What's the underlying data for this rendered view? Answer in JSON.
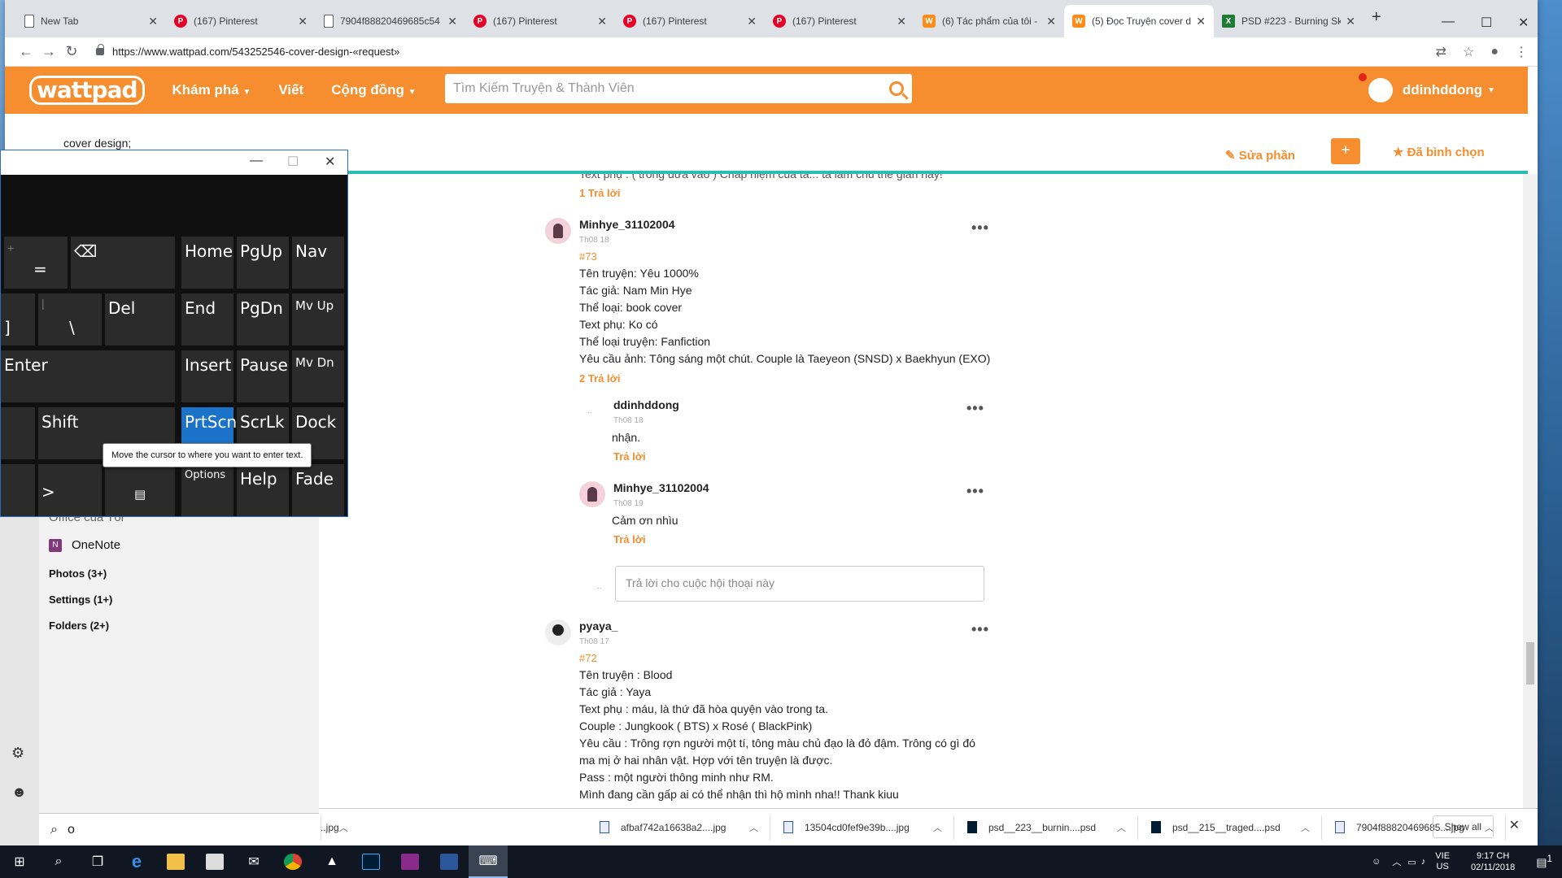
{
  "browser": {
    "tabs": [
      {
        "title": "New Tab",
        "icon": "doc"
      },
      {
        "title": "(167) Pinterest",
        "icon": "pin"
      },
      {
        "title": "7904f88820469685c54",
        "icon": "doc"
      },
      {
        "title": "(167) Pinterest",
        "icon": "pin"
      },
      {
        "title": "(167) Pinterest",
        "icon": "pin"
      },
      {
        "title": "(167) Pinterest",
        "icon": "pin"
      },
      {
        "title": "(6) Tác phẩm của tôi -",
        "icon": "wp"
      },
      {
        "title": "(5) Đọc Truyện cover d",
        "icon": "wp"
      },
      {
        "title": "PSD #223 - Burning Sk",
        "icon": "psd"
      }
    ],
    "url": "https://www.wattpad.com/543252546-cover-design-«request»"
  },
  "wattpad": {
    "logo": "wattpad",
    "menu": [
      "Khám phá",
      "Viết",
      "Cộng đồng"
    ],
    "search_placeholder": "Tìm Kiếm Truyện & Thành Viên",
    "username": "ddinhddong",
    "story_title": "cover design;",
    "edit_label": "Sửa phần",
    "plus_label": "+",
    "vote_label": "Đã bình chọn"
  },
  "comments": {
    "top_partial": "Text phụ : ( trong đưa vào ) Chấp niệm của ta... ta làm chủ thế gian này!",
    "top_reply_count": "1 Trả lời",
    "c73": {
      "user": "Minhye_31102004",
      "time": "Th08 18",
      "num": "#73",
      "lines": [
        "Tên truyện: Yêu 1000%",
        "Tác giả: Nam Min Hye",
        "Thể loại: book cover",
        "Text phụ: Ko có",
        "Thể loại truyện: Fanfiction",
        "Yêu cầu ảnh: Tông sáng một chút. Couple là Taeyeon (SNSD) x Baekhyun (EXO)"
      ],
      "reply_count": "2 Trả lời"
    },
    "r1": {
      "user": "ddinhddong",
      "time": "Th08 18",
      "text": "nhận.",
      "reply": "Trả lời"
    },
    "r2": {
      "user": "Minhye_31102004",
      "time": "Th08 19",
      "text": "Cảm ơn nhìu",
      "reply": "Trả lời"
    },
    "reply_placeholder": "Trả lời cho cuộc hội thoại này",
    "c72": {
      "user": "pyaya_",
      "time": "Th08 17",
      "num": "#72",
      "lines": [
        "Tên truyện : Blood",
        "Tác giả : Yaya",
        "Text phụ : máu, là thứ đã hòa quyện vào trong ta.",
        "Couple : Jungkook ( BTS) x Rosé ( BlackPink)",
        "Yêu cầu : Trông rợn người một tí, tông màu chủ đạo là đỏ đậm. Trông có gì đó",
        "ma mị ở hai nhân vật.  Hợp với tên truyện là được.",
        "Pass : một người thông minh như RM.",
        "Mình đang cần gấp ai có thể nhận thì hộ mình nha!! Thank kiuu"
      ]
    },
    "more": "•••"
  },
  "downloads": {
    "items": [
      {
        "name": "afbaf742a16638a2....jpg",
        "type": "jpg"
      },
      {
        "name": "13504cd0fef9e39b....jpg",
        "type": "jpg"
      },
      {
        "name": "psd__223__burnin....psd",
        "type": "psd"
      },
      {
        "name": "psd__215__traged....psd",
        "type": "psd"
      },
      {
        "name": "7904f88820469685....jpg",
        "type": "jpg"
      }
    ],
    "first_partial": "..jpg",
    "show_all": "Show all"
  },
  "startmenu": {
    "partial": "Office của Tôi",
    "app": "OneNote",
    "groups": [
      "Photos (3+)",
      "Settings (1+)",
      "Folders (2+)"
    ],
    "search_value": "o"
  },
  "osk": {
    "keys": {
      "eq": "=",
      "plus": "+",
      "bksp": "⌫",
      "home": "Home",
      "pgup": "PgUp",
      "nav": "Nav",
      "rbr": "]",
      "bsl": "\\",
      "pipe": "|",
      "del": "Del",
      "end": "End",
      "pgdn": "PgDn",
      "mvup": "Mv Up",
      "enter": "Enter",
      "insert": "Insert",
      "pause": "Pause",
      "mvdn": "Mv Dn",
      "shift": "Shift",
      "prtscn": "PrtScn",
      "scrlk": "ScrLk",
      "dock": "Dock",
      "arrow": ">",
      "menu": "▤",
      "options": "Options",
      "help": "Help",
      "fade": "Fade"
    },
    "tooltip": "Move the cursor to where you want to enter text."
  },
  "taskbar": {
    "lang1": "VIE",
    "lang2": "US",
    "time": "9:17 CH",
    "date": "02/11/2018",
    "notif_count": "1"
  },
  "colors": {
    "wattpad_orange": "#f68d2e",
    "teal": "#2bbdb3"
  }
}
